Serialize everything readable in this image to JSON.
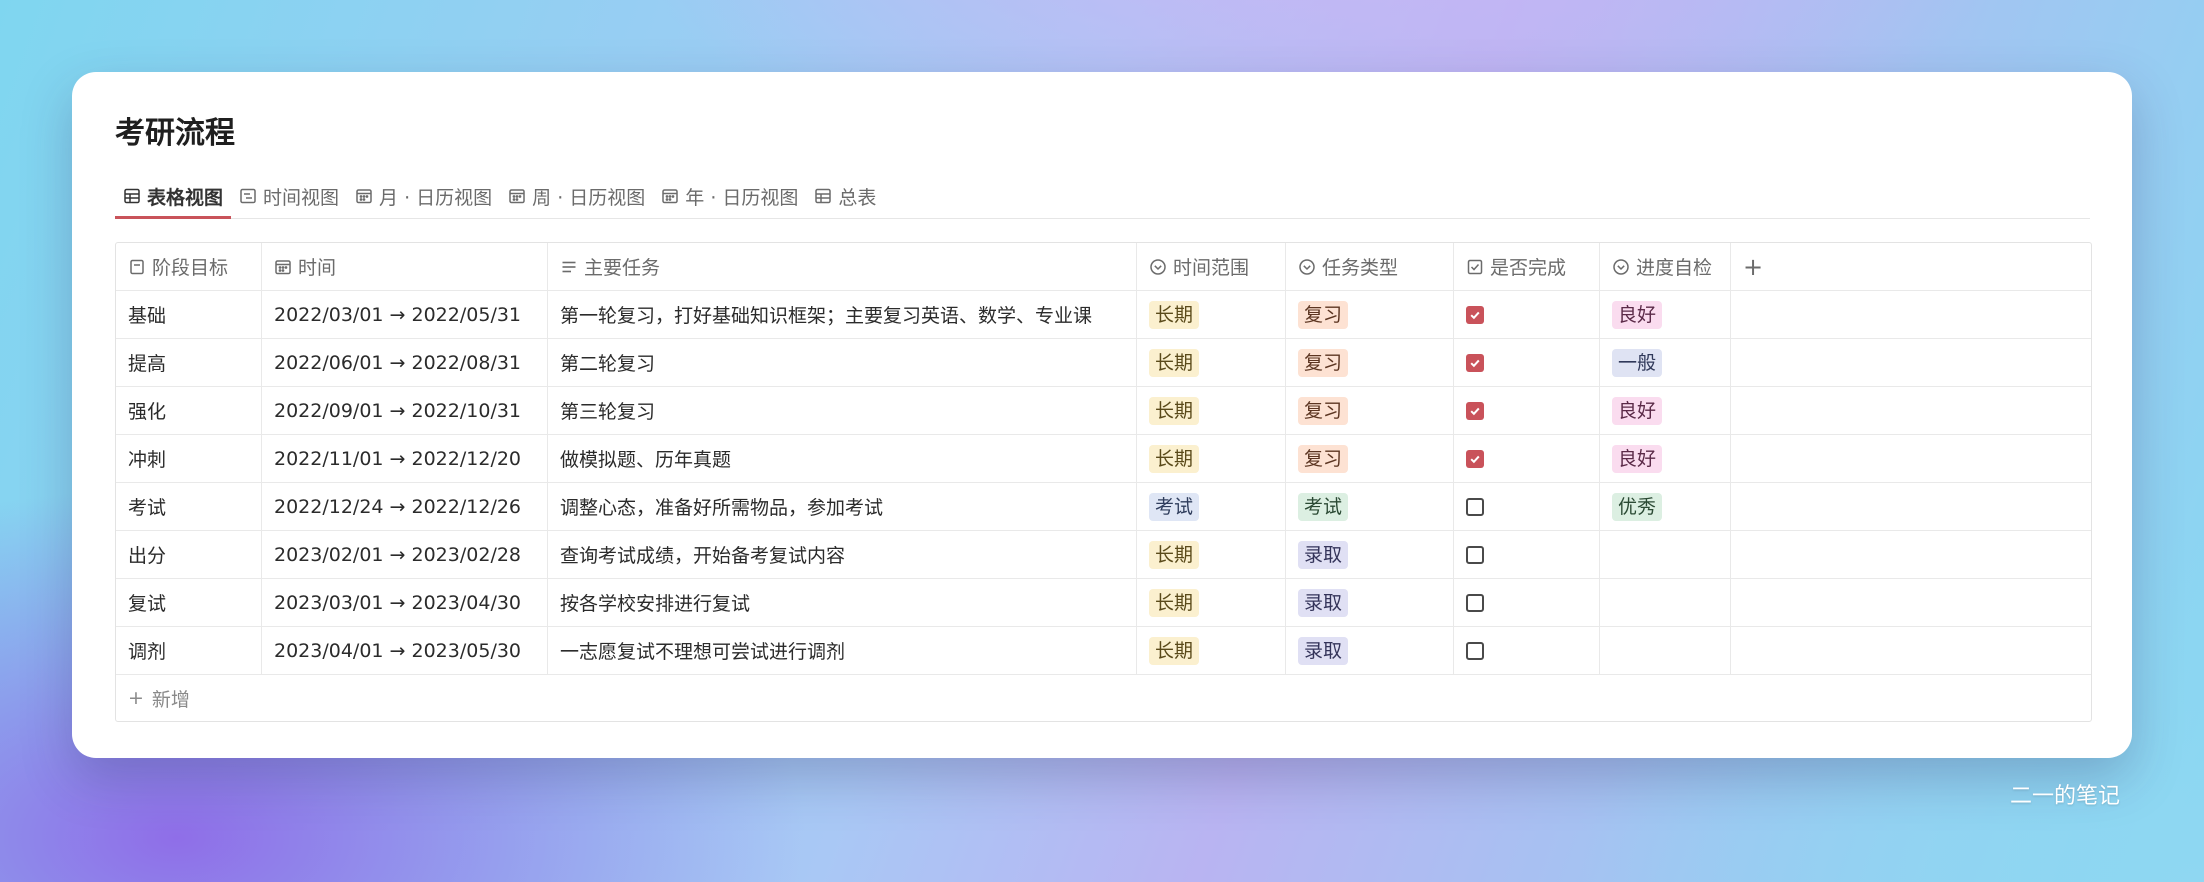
{
  "page": {
    "title": "考研流程"
  },
  "tabs": [
    {
      "label": "表格视图",
      "icon": "table-icon",
      "active": true
    },
    {
      "label": "时间视图",
      "icon": "timeline-icon",
      "active": false
    },
    {
      "label": "月 · 日历视图",
      "icon": "calendar-icon",
      "active": false
    },
    {
      "label": "周 · 日历视图",
      "icon": "calendar-icon",
      "active": false
    },
    {
      "label": "年 · 日历视图",
      "icon": "calendar-icon",
      "active": false
    },
    {
      "label": "总表",
      "icon": "table-icon",
      "active": false
    }
  ],
  "table": {
    "columns": [
      {
        "label": "阶段目标",
        "icon": "text-icon"
      },
      {
        "label": "时间",
        "icon": "calendar-icon"
      },
      {
        "label": "主要任务",
        "icon": "lines-icon"
      },
      {
        "label": "时间范围",
        "icon": "select-icon"
      },
      {
        "label": "任务类型",
        "icon": "select-icon"
      },
      {
        "label": "是否完成",
        "icon": "checkbox-icon"
      },
      {
        "label": "进度自检",
        "icon": "select-icon"
      }
    ],
    "add_column": "+",
    "rows": [
      {
        "stage": "基础",
        "time": "2022/03/01 → 2022/05/31",
        "task": "第一轮复习，打好基础知识框架；主要复习英语、数学、专业课",
        "range": "长期",
        "type": "复习",
        "done": true,
        "progress": "良好"
      },
      {
        "stage": "提高",
        "time": "2022/06/01 → 2022/08/31",
        "task": "第二轮复习",
        "range": "长期",
        "type": "复习",
        "done": true,
        "progress": "一般"
      },
      {
        "stage": "强化",
        "time": "2022/09/01 → 2022/10/31",
        "task": "第三轮复习",
        "range": "长期",
        "type": "复习",
        "done": true,
        "progress": "良好"
      },
      {
        "stage": "冲刺",
        "time": "2022/11/01 → 2022/12/20",
        "task": "做模拟题、历年真题",
        "range": "长期",
        "type": "复习",
        "done": true,
        "progress": "良好"
      },
      {
        "stage": "考试",
        "time": "2022/12/24 → 2022/12/26",
        "task": "调整心态，准备好所需物品，参加考试",
        "range": "考试",
        "type": "考试",
        "done": false,
        "progress": "优秀"
      },
      {
        "stage": "出分",
        "time": "2023/02/01 → 2023/02/28",
        "task": "查询考试成绩，开始备考复试内容",
        "range": "长期",
        "type": "录取",
        "done": false,
        "progress": ""
      },
      {
        "stage": "复试",
        "time": "2023/03/01 → 2023/04/30",
        "task": "按各学校安排进行复试",
        "range": "长期",
        "type": "录取",
        "done": false,
        "progress": ""
      },
      {
        "stage": "调剂",
        "time": "2023/04/01 → 2023/05/30",
        "task": "一志愿复试不理想可尝试进行调剂",
        "range": "长期",
        "type": "录取",
        "done": false,
        "progress": ""
      }
    ],
    "add_row": "新增"
  },
  "tag_colors": {
    "长期": {
      "bg": "#fbf0cf",
      "fg": "#5a4a1a"
    },
    "考试": {
      "bg": "#dfe6f5",
      "fg": "#2f3d5c"
    },
    "复习": {
      "bg": "#fde2d3",
      "fg": "#5c3521"
    },
    "考试类型": {
      "bg": "#dcefe2",
      "fg": "#2b4a34"
    },
    "录取": {
      "bg": "#e0e0f4",
      "fg": "#34345a"
    },
    "良好": {
      "bg": "#fadcef",
      "fg": "#5b2a48"
    },
    "一般": {
      "bg": "#dfe3f3",
      "fg": "#30395a"
    },
    "优秀": {
      "bg": "#dcefe2",
      "fg": "#2b4a34"
    }
  },
  "accent": "#c9535a",
  "watermark": "二一的笔记"
}
